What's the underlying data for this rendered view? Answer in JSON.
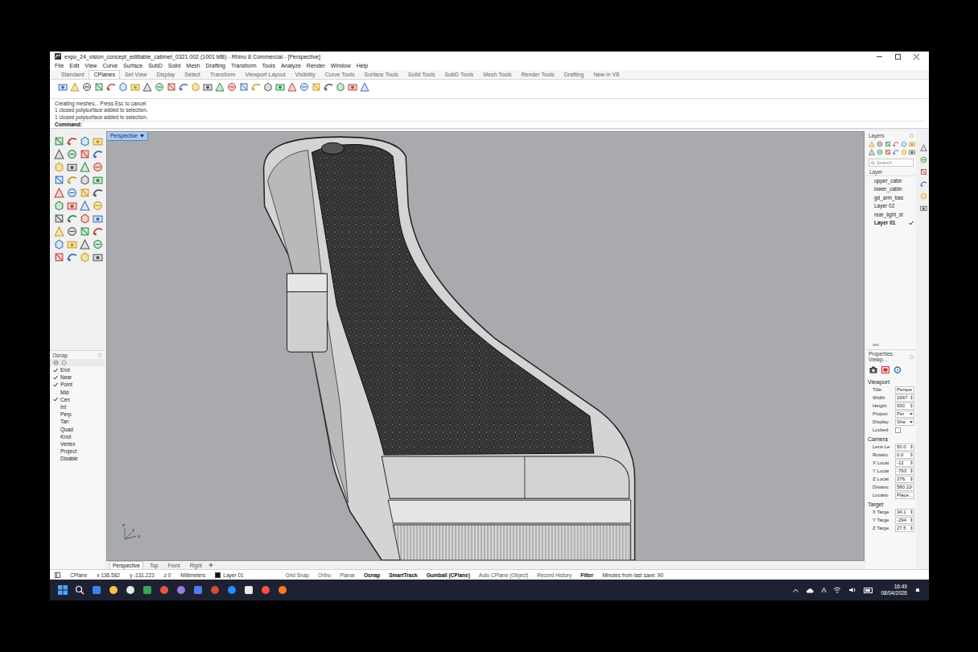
{
  "window": {
    "title": "expo_24_vision_concept_edittable_cabinet_0321 002 (1001 MB) - Rhino 8 Commercial - [Perspective]"
  },
  "menu": [
    "File",
    "Edit",
    "View",
    "Curve",
    "Surface",
    "SubD",
    "Solid",
    "Mesh",
    "Drafting",
    "Transform",
    "Tools",
    "Analyze",
    "Render",
    "Window",
    "Help"
  ],
  "toolbar_tabs": [
    {
      "label": "Standard",
      "selected": false
    },
    {
      "label": "CPlanes",
      "selected": true
    },
    {
      "label": "Set View",
      "selected": false
    },
    {
      "label": "Display",
      "selected": false
    },
    {
      "label": "Select",
      "selected": false
    },
    {
      "label": "Transform",
      "selected": false
    },
    {
      "label": "Viewport Layout",
      "selected": false
    },
    {
      "label": "Visibility",
      "selected": false
    },
    {
      "label": "Curve Tools",
      "selected": false
    },
    {
      "label": "Surface Tools",
      "selected": false
    },
    {
      "label": "Solid Tools",
      "selected": false
    },
    {
      "label": "SubD Tools",
      "selected": false
    },
    {
      "label": "Mesh Tools",
      "selected": false
    },
    {
      "label": "Render Tools",
      "selected": false
    },
    {
      "label": "Drafting",
      "selected": false
    },
    {
      "label": "New in V8",
      "selected": false
    }
  ],
  "command_history": [
    "Creating meshes... Press Esc to cancel",
    "1 closed polysurface added to selection.",
    "1 closed polysurface added to selection."
  ],
  "command_prompt": "Command:",
  "viewport": {
    "label": "Perspective",
    "axes": [
      "z",
      "y",
      "x"
    ]
  },
  "viewport_tabs": [
    {
      "label": "Perspective",
      "selected": true
    },
    {
      "label": "Top",
      "selected": false
    },
    {
      "label": "Front",
      "selected": false
    },
    {
      "label": "Right",
      "selected": false
    }
  ],
  "osnap": {
    "title": "Osnap",
    "items": [
      {
        "label": "End",
        "checked": true
      },
      {
        "label": "Near",
        "checked": true
      },
      {
        "label": "Point",
        "checked": true
      },
      {
        "label": "Mid",
        "checked": false
      },
      {
        "label": "Cen",
        "checked": true
      },
      {
        "label": "Int",
        "checked": false
      },
      {
        "label": "Perp",
        "checked": false
      },
      {
        "label": "Tan",
        "checked": false
      },
      {
        "label": "Quad",
        "checked": false
      },
      {
        "label": "Knot",
        "checked": false
      },
      {
        "label": "Vertex",
        "checked": false
      },
      {
        "label": "Project",
        "checked": false
      },
      {
        "label": "Disable",
        "checked": false
      }
    ]
  },
  "layers": {
    "title": "Layers",
    "search_placeholder": "Search",
    "column": "Layer",
    "items": [
      {
        "name": "upper_cabir",
        "current": false
      },
      {
        "name": "lower_cabin",
        "current": false
      },
      {
        "name": "gd_arm_bas",
        "current": false
      },
      {
        "name": "Layer 02",
        "current": false
      },
      {
        "name": "rear_light_st",
        "current": false
      },
      {
        "name": "Layer 01",
        "current": true
      }
    ]
  },
  "properties": {
    "title": "Properties: Viewp...",
    "sections": [
      {
        "title": "Viewport",
        "rows": [
          {
            "label": "Title",
            "value": "Perspe",
            "kind": "text"
          },
          {
            "label": "Width",
            "value": "1667",
            "kind": "number"
          },
          {
            "label": "Height",
            "value": "930",
            "kind": "number"
          },
          {
            "label": "Project",
            "value": "Per",
            "kind": "dropdown"
          },
          {
            "label": "Display",
            "value": "Sha",
            "kind": "dropdown"
          },
          {
            "label": "Locked",
            "value": "",
            "kind": "checkbox",
            "checked": false
          }
        ]
      },
      {
        "title": "Camera",
        "rows": [
          {
            "label": "Lens Le",
            "value": "50.0",
            "kind": "number"
          },
          {
            "label": "Rotatio",
            "value": "0.0",
            "kind": "number"
          },
          {
            "label": "X Locat",
            "value": "-12",
            "kind": "number"
          },
          {
            "label": "Y Locat",
            "value": "-793",
            "kind": "number"
          },
          {
            "label": "Z Locat",
            "value": "276.",
            "kind": "number"
          },
          {
            "label": "Distanc",
            "value": "580.22",
            "kind": "number"
          },
          {
            "label": "Locatio",
            "value": "Place...",
            "kind": "button"
          }
        ]
      },
      {
        "title": "Target",
        "rows": [
          {
            "label": "X Targe",
            "value": "34.1",
            "kind": "number"
          },
          {
            "label": "Y Targe",
            "value": "-294",
            "kind": "number"
          },
          {
            "label": "Z Targe",
            "value": "27.5",
            "kind": "number"
          }
        ]
      }
    ]
  },
  "status_bar": {
    "cplane": "CPlane",
    "x": "x 136.582",
    "y": "y -131.223",
    "z": "z 0",
    "units": "Millimeters",
    "layer": {
      "name": "Layer 01",
      "color": "#111111"
    },
    "toggles": [
      {
        "label": "Grid Snap",
        "on": false
      },
      {
        "label": "Ortho",
        "on": false
      },
      {
        "label": "Planar",
        "on": false
      },
      {
        "label": "Osnap",
        "on": true
      },
      {
        "label": "SmartTrack",
        "on": true
      },
      {
        "label": "Gumball (CPlane)",
        "on": true
      },
      {
        "label": "Auto CPlane (Object)",
        "on": false
      },
      {
        "label": "Record History",
        "on": false
      },
      {
        "label": "Filter",
        "on": true
      }
    ],
    "save_info": "Minutes from last save: 90"
  },
  "taskbar": {
    "tray_letter": "A",
    "time": "16:49",
    "date": "08/04/2026"
  }
}
